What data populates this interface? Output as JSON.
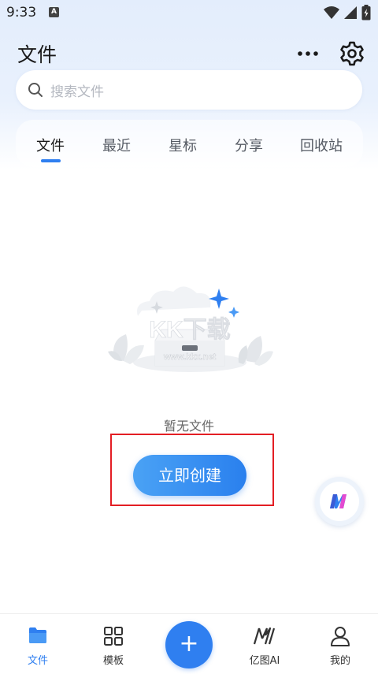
{
  "status_bar": {
    "time": "9:33",
    "notification_icon": "A"
  },
  "header": {
    "title": "文件",
    "more_icon": "more-icon",
    "settings_icon": "gear-icon"
  },
  "search": {
    "placeholder": "搜索文件",
    "icon": "search-icon"
  },
  "tabs": [
    {
      "label": "文件",
      "active": true
    },
    {
      "label": "最近",
      "active": false
    },
    {
      "label": "星标",
      "active": false
    },
    {
      "label": "分享",
      "active": false
    },
    {
      "label": "回收站",
      "active": false
    }
  ],
  "empty_state": {
    "text": "暂无文件",
    "button_label": "立即创建",
    "watermark": "KK下载 www.kkx.net"
  },
  "bottom_nav": {
    "items": [
      {
        "label": "文件",
        "icon": "folder-icon",
        "active": true
      },
      {
        "label": "模板",
        "icon": "grid-icon",
        "active": false
      },
      {
        "label": "亿图AI",
        "icon": "ai-icon",
        "active": false
      },
      {
        "label": "我的",
        "icon": "user-icon",
        "active": false
      }
    ],
    "fab_label": "+"
  },
  "colors": {
    "accent": "#2f7ff0",
    "highlight": "#e31e24",
    "background_top": "#e3edfc"
  }
}
